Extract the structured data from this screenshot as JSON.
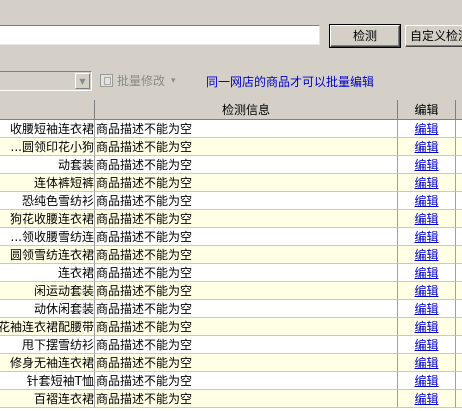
{
  "toolbar_top": {
    "check_label": "检测",
    "custom_label": "自定义检测"
  },
  "toolbar": {
    "batch_label": "批量修改",
    "batch_caret": "▾",
    "notice": "同一网店的商品才可以批量编辑"
  },
  "grid": {
    "columns": [
      "",
      "检测信息",
      "编辑"
    ],
    "rows": [
      {
        "name": "收腰短袖连衣裙",
        "info": "商品描述不能为空",
        "edit": "编辑"
      },
      {
        "name": "圆领印花小狗...",
        "info": "商品描述不能为空",
        "edit": "编辑"
      },
      {
        "name": "动套装",
        "info": "商品描述不能为空",
        "edit": "编辑"
      },
      {
        "name": "连体裤短裤",
        "info": "商品描述不能为空",
        "edit": "编辑"
      },
      {
        "name": "恐纯色雪纺衫",
        "info": "商品描述不能为空",
        "edit": "编辑"
      },
      {
        "name": "狗花收腰连衣裙",
        "info": "商品描述不能为空",
        "edit": "编辑"
      },
      {
        "name": "领收腰雪纺连...",
        "info": "商品描述不能为空",
        "edit": "编辑"
      },
      {
        "name": "圆领雪纺连衣裙",
        "info": "商品描述不能为空",
        "edit": "编辑"
      },
      {
        "name": "连衣裙",
        "info": "商品描述不能为空",
        "edit": "编辑"
      },
      {
        "name": "闲运动套装",
        "info": "商品描述不能为空",
        "edit": "编辑"
      },
      {
        "name": "动休闲套装",
        "info": "商品描述不能为空",
        "edit": "编辑"
      },
      {
        "name": "花袖连衣裙配腰带",
        "info": "商品描述不能为空",
        "edit": "编辑"
      },
      {
        "name": "甩下摆雪纺衫",
        "info": "商品描述不能为空",
        "edit": "编辑"
      },
      {
        "name": "修身无袖连衣裙",
        "info": "商品描述不能为空",
        "edit": "编辑"
      },
      {
        "name": "针套短袖T恤",
        "info": "商品描述不能为空",
        "edit": "编辑"
      },
      {
        "name": "百褶连衣裙",
        "info": "商品描述不能为空",
        "edit": "编辑"
      }
    ]
  }
}
